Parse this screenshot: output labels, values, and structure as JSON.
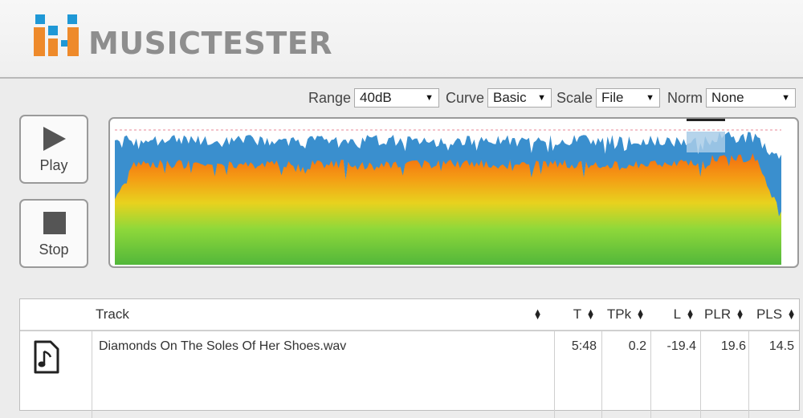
{
  "app": {
    "brand": "MUSICTESTER"
  },
  "colors": {
    "logo_blue": "#1f98d6",
    "logo_orange": "#ee8a2b",
    "logo_text": "#8e8e8e",
    "wave_blue": "#3a8fce",
    "wave_orange": "#f27a14",
    "wave_green": "#62c83a"
  },
  "toolbar": {
    "range": {
      "label": "Range",
      "value": "40dB"
    },
    "curve": {
      "label": "Curve",
      "value": "Basic"
    },
    "scale": {
      "label": "Scale",
      "value": "File"
    },
    "norm": {
      "label": "Norm",
      "value": "None"
    }
  },
  "controls": {
    "play": {
      "label": "Play",
      "icon": "play-icon"
    },
    "stop": {
      "label": "Stop",
      "icon": "stop-icon"
    }
  },
  "table": {
    "columns": {
      "track": "Track",
      "t": "T",
      "tpk": "TPk",
      "l": "L",
      "plr": "PLR",
      "pls": "PLS"
    },
    "rows": [
      {
        "icon": "music-file-icon",
        "track": "Diamonds On The Soles Of Her Shoes.wav",
        "t": "5:48",
        "tpk": "0.2",
        "l": "-19.4",
        "plr": "19.6",
        "pls": "14.5"
      }
    ]
  }
}
